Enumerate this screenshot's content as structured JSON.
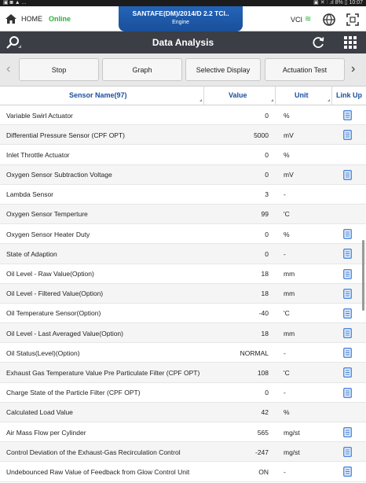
{
  "status_bar": {
    "left": "▣ ◙ ▲ ...",
    "right": "▣ ✕ ⫶ .ıl 8% ▯ 10:07"
  },
  "top_bar": {
    "home_label": "HOME",
    "connection_status": "Online",
    "vehicle_model": "SANTAFE(DM)/2014/D 2.2 TCI..",
    "vehicle_system": "Engine",
    "vci_label": "VCI",
    "vci_signal_icon": "wifi-signal-icon"
  },
  "title_bar": {
    "title": "Data Analysis"
  },
  "buttons": {
    "stop": "Stop",
    "graph": "Graph",
    "selective_display": "Selective Display",
    "actuation_test": "Actuation Test",
    "prev_arrow": "‹",
    "next_arrow": "›"
  },
  "table": {
    "headers": {
      "sensor_name": "Sensor Name(97)",
      "value": "Value",
      "unit": "Unit",
      "link_up": "Link Up"
    },
    "rows": [
      {
        "name": "Variable Swirl Actuator",
        "value": "0",
        "unit": "%",
        "link": true
      },
      {
        "name": "Differential Pressure Sensor (CPF OPT)",
        "value": "5000",
        "unit": "mV",
        "link": true
      },
      {
        "name": "Inlet Throttle Actuator",
        "value": "0",
        "unit": "%",
        "link": false
      },
      {
        "name": "Oxygen Sensor Subtraction Voltage",
        "value": "0",
        "unit": "mV",
        "link": true
      },
      {
        "name": "Lambda Sensor",
        "value": "3",
        "unit": "-",
        "link": false
      },
      {
        "name": "Oxygen Sensor Temperture",
        "value": "99",
        "unit": "'C",
        "link": false
      },
      {
        "name": "Oxygen Sensor Heater Duty",
        "value": "0",
        "unit": "%",
        "link": true
      },
      {
        "name": "State of Adaption",
        "value": "0",
        "unit": "-",
        "link": true
      },
      {
        "name": "Oil Level - Raw Value(Option)",
        "value": "18",
        "unit": "mm",
        "link": true
      },
      {
        "name": "Oil Level - Filtered Value(Option)",
        "value": "18",
        "unit": "mm",
        "link": true
      },
      {
        "name": "Oil Temperature Sensor(Option)",
        "value": "-40",
        "unit": "'C",
        "link": true
      },
      {
        "name": "Oil Level - Last Averaged Value(Option)",
        "value": "18",
        "unit": "mm",
        "link": true
      },
      {
        "name": "Oil Status(Level)(Option)",
        "value": "NORMAL",
        "unit": "-",
        "link": true
      },
      {
        "name": "Exhaust Gas Temperature Value Pre Particulate Filter (CPF OPT)",
        "value": "108",
        "unit": "'C",
        "link": true
      },
      {
        "name": "Charge State of the Particle Filter (CPF OPT)",
        "value": "0",
        "unit": "-",
        "link": true
      },
      {
        "name": "Calculated Load Value",
        "value": "42",
        "unit": "%",
        "link": false
      },
      {
        "name": "Air Mass Flow per Cylinder",
        "value": "565",
        "unit": "mg/st",
        "link": true
      },
      {
        "name": "Control Deviation of the Exhaust-Gas Recirculation Control",
        "value": "-247",
        "unit": "mg/st",
        "link": true
      },
      {
        "name": "Undebounced Raw Value of Feedback from Glow Control Unit",
        "value": "ON",
        "unit": "-",
        "link": true
      }
    ]
  },
  "colors": {
    "title_bar_bg": "#3b3e45",
    "vehicle_tab_bg": "#2364b8",
    "header_text": "#1b4fa0",
    "online_green": "#2fae3a",
    "link_icon": "#3a7bd5"
  }
}
